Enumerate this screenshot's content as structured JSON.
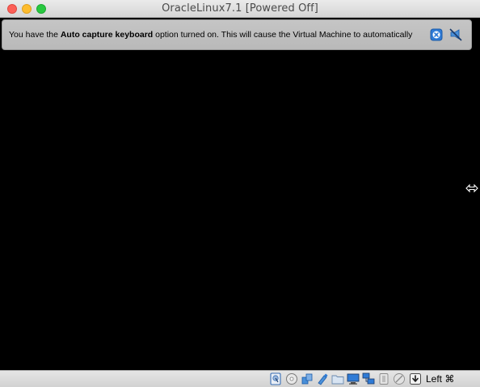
{
  "window": {
    "title": "OracleLinux7.1 [Powered Off]"
  },
  "banner": {
    "text_prefix": "You have the ",
    "text_bold": "Auto capture keyboard",
    "text_suffix": " option turned on. This will cause the Virtual Machine to automatically",
    "close_icon": "close-message-icon",
    "mute_icon": "mute-messages-icon"
  },
  "statusbar": {
    "icons": [
      "hard-disk-icon",
      "optical-drive-icon",
      "audio-icon",
      "usb-icon",
      "shared-folders-icon",
      "display-icon",
      "network-icon",
      "recording-icon",
      "cpu-icon",
      "mouse-integration-icon",
      "keyboard-capture-icon"
    ],
    "host_key": "Left ⌘"
  },
  "colors": {
    "screen": "#000000",
    "titlebar": "#e0e0e0",
    "banner": "#bfbfbf",
    "accent": "#2f7bd6"
  }
}
